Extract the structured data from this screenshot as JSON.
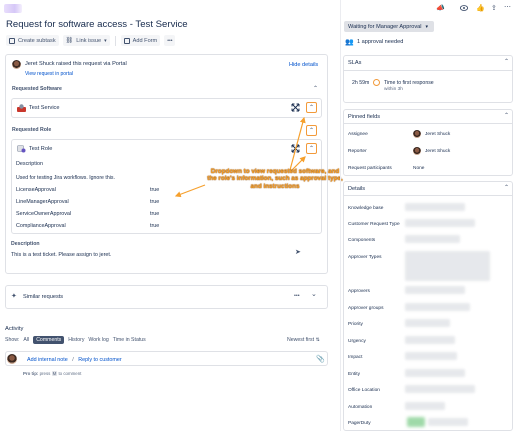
{
  "title": "Request for software access - Test Service",
  "toolbar": {
    "create_subtask": "Create subtask",
    "link_issue": "Link issue",
    "add_form": "Add Form",
    "more": "•••"
  },
  "request": {
    "reporter_line_name": "Jeret Shuck",
    "reporter_line_rest": " raised this request via ",
    "reporter_line_channel": "Portal",
    "view_portal": "View request in portal",
    "hide_details": "Hide details"
  },
  "requested_software": {
    "heading": "Requested Software",
    "item": "Test Service"
  },
  "requested_role": {
    "heading": "Requested Role",
    "item": "Test Role",
    "description_label": "Description",
    "description_text": "Used for testing Jira workflows. Ignore this.",
    "rows": [
      {
        "label": "LicenseApproval",
        "value": "true"
      },
      {
        "label": "LineManagerApproval",
        "value": "true"
      },
      {
        "label": "ServiceOwnerApproval",
        "value": "true"
      },
      {
        "label": "ComplianceApproval",
        "value": "true"
      }
    ]
  },
  "description": {
    "label": "Description",
    "text": "This is a test ticket. Please assign to jeret."
  },
  "annotation": "Dropdown to view requested software, and the role's information, such as approval type, and instructions",
  "similar": {
    "label": "Similar requests",
    "more": "•••",
    "chevron": "⌄"
  },
  "activity": {
    "heading": "Activity",
    "show_label": "Show:",
    "tabs": [
      "All",
      "Comments",
      "History",
      "Work log",
      "Time in Status"
    ],
    "active_tab": "Comments",
    "sort": "Newest first",
    "add_internal_note": "Add internal note",
    "separator": "/",
    "reply": "Reply to customer",
    "pro_tip_bold": "Pro tip:",
    "pro_tip_press": " press ",
    "pro_tip_key": "M",
    "pro_tip_rest": " to comment"
  },
  "sidebar": {
    "status": "Waiting for Manager Approval",
    "approvals": "1 approval needed",
    "slas_title": "SLAs",
    "sla_time": "2h 59m",
    "sla_name": "Time to first response",
    "sla_within": "within 3h",
    "pinned_title": "Pinned fields",
    "assignee_label": "Assignee",
    "assignee": "Jeret Shuck",
    "reporter_label": "Reporter",
    "reporter": "Jeret Shuck",
    "participants_label": "Request participants",
    "participants": "None",
    "details_title": "Details",
    "details_fields": [
      "Knowledge base",
      "Customer Request Type",
      "Components",
      "Approver Types",
      "Approvers",
      "Approver groups",
      "Priority",
      "Urgency",
      "Impact",
      "Entity",
      "Office Location",
      "Automation",
      "PagerDuty"
    ]
  },
  "colors": {
    "link": "#0052cc",
    "annotation": "#f6a02d",
    "sla_icon": "#f29a3a"
  }
}
